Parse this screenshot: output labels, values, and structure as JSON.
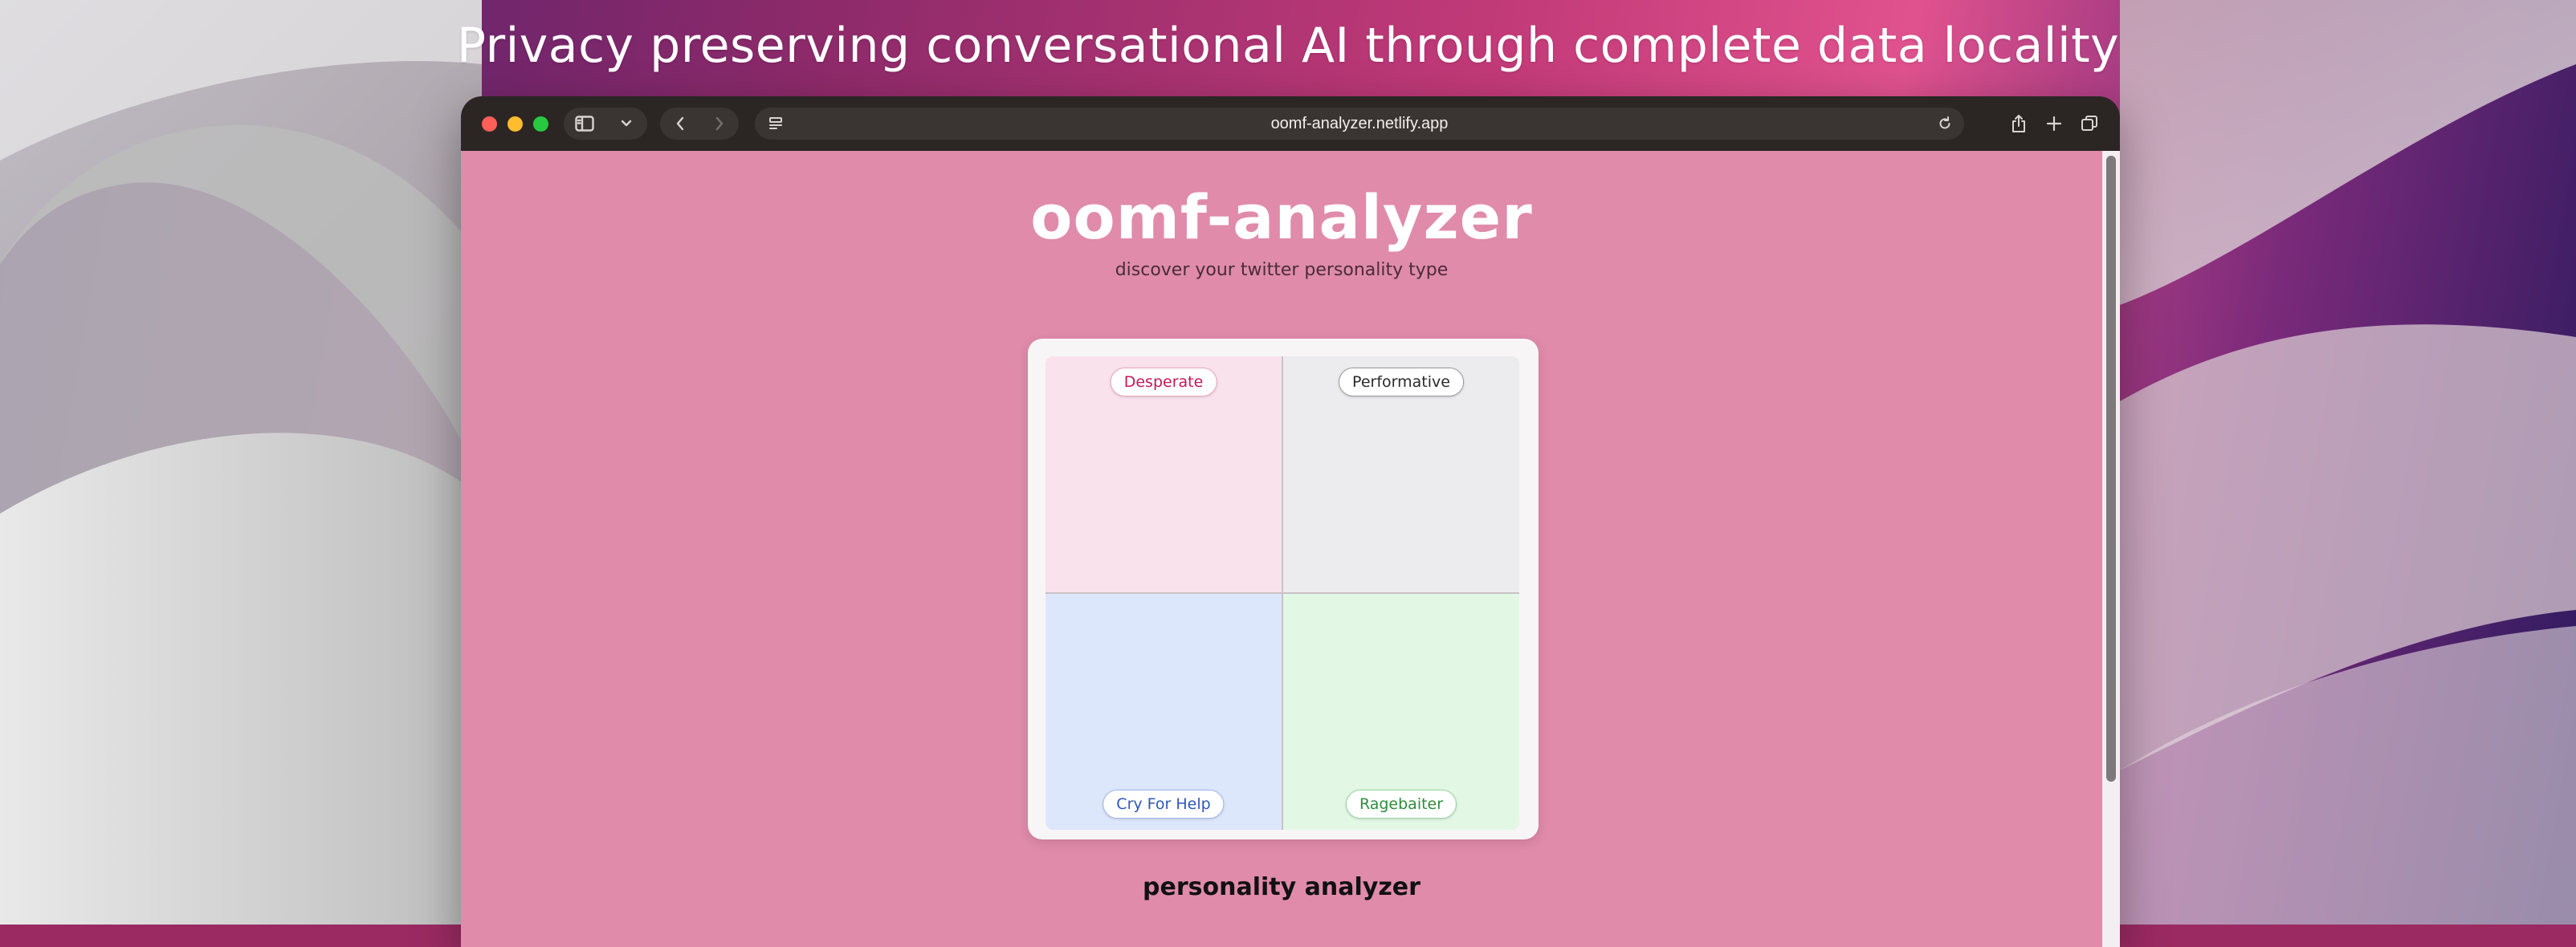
{
  "headline": "Privacy preserving conversational AI through complete data locality",
  "browser": {
    "url": "oomf-analyzer.netlify.app",
    "toolbar_icons": [
      "sidebar-icon",
      "chevron-down-icon",
      "back-icon",
      "forward-icon",
      "page-settings-icon",
      "reload-icon",
      "share-icon",
      "new-tab-icon",
      "tab-overview-icon"
    ]
  },
  "page": {
    "title": "oomf-analyzer",
    "subtitle": "discover your twitter personality type",
    "quadrants": [
      {
        "label": "Desperate",
        "color": "#f9e2ec"
      },
      {
        "label": "Performative",
        "color": "#ececee"
      },
      {
        "label": "Cry For Help",
        "color": "#dde7fb"
      },
      {
        "label": "Ragebaiter",
        "color": "#e2f8e4"
      }
    ],
    "section_heading": "personality analyzer"
  },
  "colors": {
    "page_background": "#e08baa",
    "toolbar": "#2b2624"
  }
}
